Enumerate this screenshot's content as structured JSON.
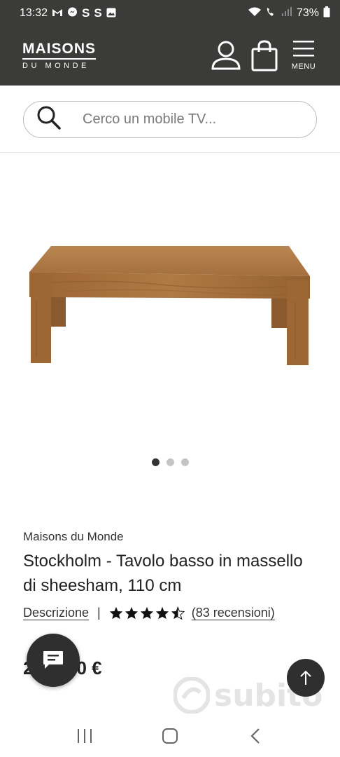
{
  "status_bar": {
    "time": "13:32",
    "battery": "73%",
    "notification_icons": [
      "gmail-icon",
      "messenger-icon",
      "s-icon",
      "s-icon",
      "gallery-icon"
    ]
  },
  "header": {
    "logo_line1": "MAISONS",
    "logo_line2": "DU MONDE",
    "menu_label": "MENU"
  },
  "search": {
    "placeholder": "Cerco un mobile TV..."
  },
  "gallery": {
    "dot_count": 3,
    "active_index": 0
  },
  "product": {
    "brand": "Maisons du Monde",
    "title": "Stockholm - Tavolo basso in massello di sheesham, 110 cm",
    "description_link": "Descrizione",
    "separator": "|",
    "rating": 4.5,
    "rating_max": 5,
    "reviews_link": "(83 recensioni)",
    "price_visible_start": "2",
    "price_visible_end": "0 €"
  },
  "watermark": {
    "text": "subito"
  },
  "colors": {
    "header_bg": "#3b3b39",
    "dark_button": "#2f2f2f",
    "wood": "#a8713f"
  }
}
